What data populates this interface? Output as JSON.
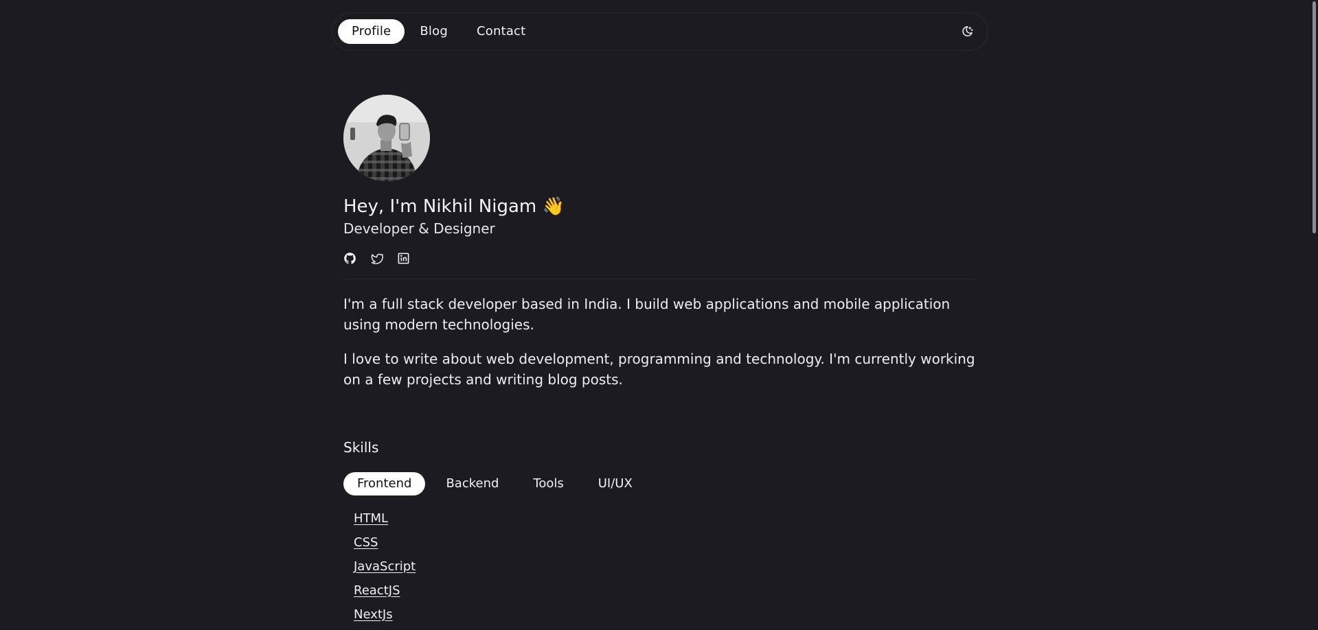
{
  "nav": {
    "items": [
      {
        "label": "Profile",
        "active": true
      },
      {
        "label": "Blog",
        "active": false
      },
      {
        "label": "Contact",
        "active": false
      }
    ],
    "theme_toggle_icon": "moon-stars-icon"
  },
  "profile": {
    "avatar_icon": "profile-photo",
    "headline": "Hey, I'm Nikhil Nigam",
    "wave_emoji": "👋",
    "subtitle": "Developer & Designer",
    "socials": [
      "github-icon",
      "twitter-icon",
      "linkedin-icon"
    ]
  },
  "bio": {
    "paragraph_1": "I'm a full stack developer based in India. I build web applications and mobile application using modern technologies.",
    "paragraph_2": "I love to write about web development, programming and technology. I'm currently working on a few projects and writing blog posts."
  },
  "skills": {
    "heading": "Skills",
    "tabs": [
      {
        "label": "Frontend",
        "active": true
      },
      {
        "label": "Backend",
        "active": false
      },
      {
        "label": "Tools",
        "active": false
      },
      {
        "label": "UI/UX",
        "active": false
      }
    ],
    "items": [
      "HTML",
      "CSS",
      "JavaScript",
      "ReactJS",
      "NextJs"
    ]
  },
  "colors": {
    "background": "#1c1b22",
    "text": "#f2f2f4",
    "active_pill": "#ffffff",
    "active_pill_text": "#111015"
  }
}
